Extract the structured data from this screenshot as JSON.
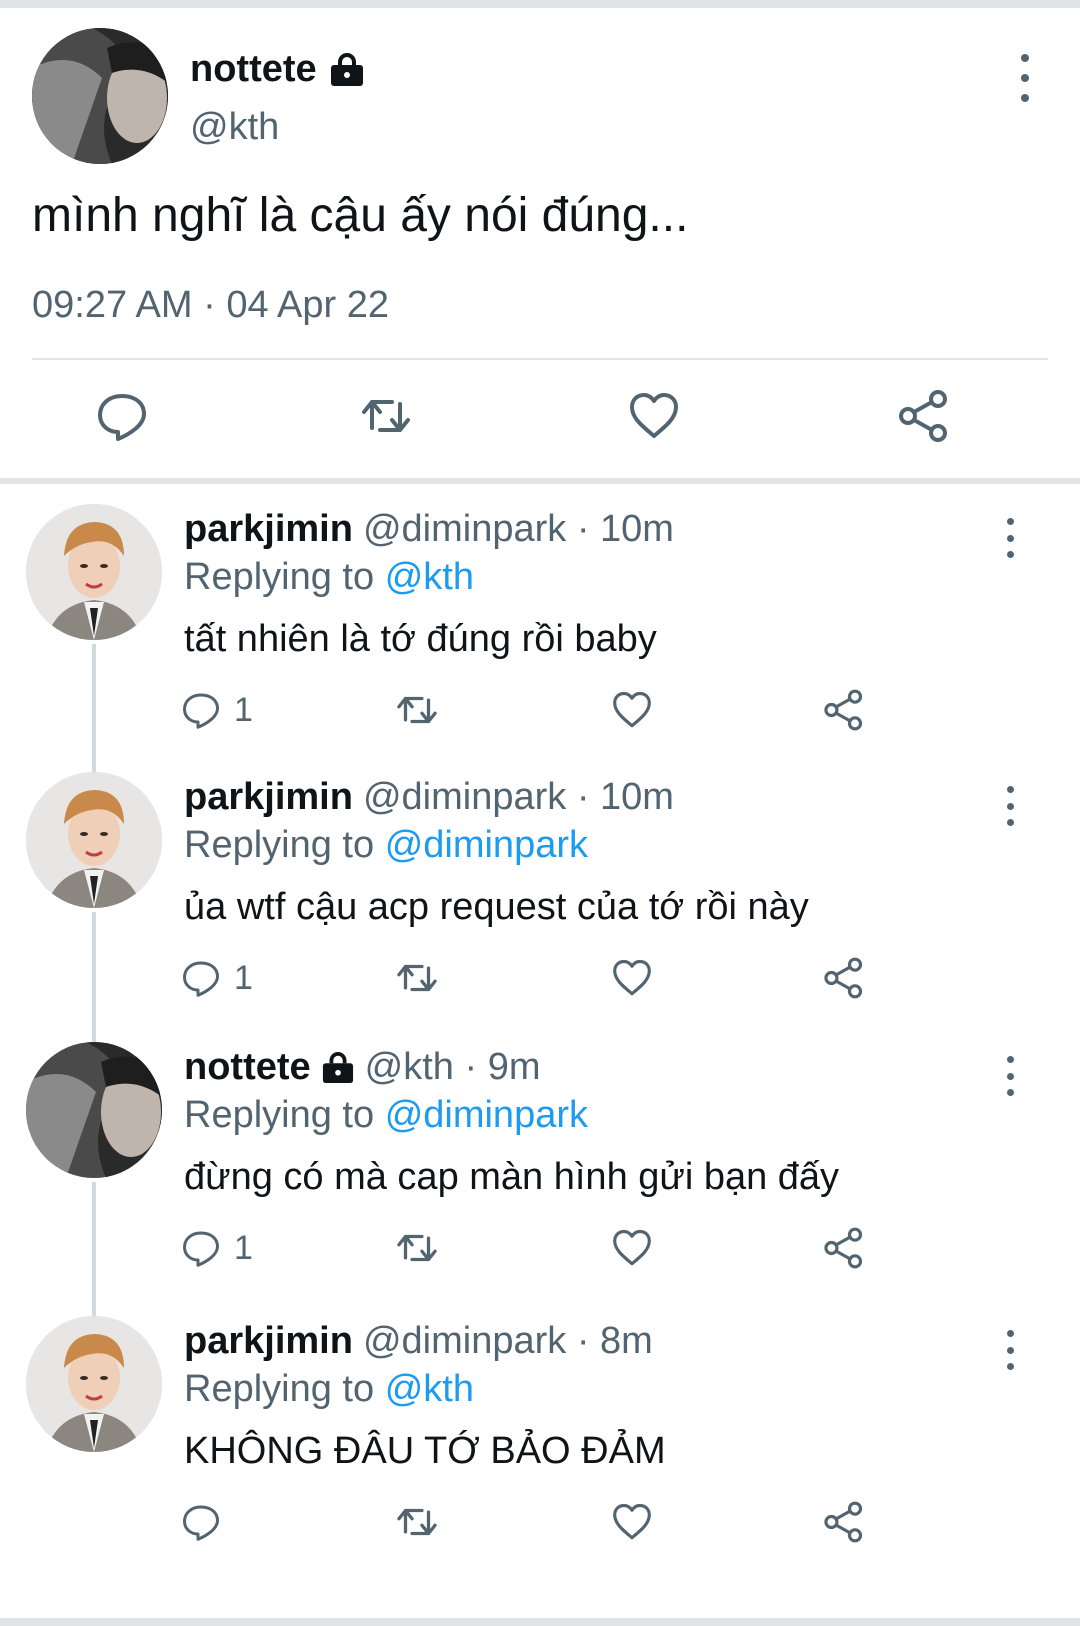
{
  "main_tweet": {
    "display_name": "nottete",
    "handle": "@kth",
    "text": "mình nghĩ là cậu ấy nói đúng...",
    "timestamp": "09:27 AM · 04 Apr 22",
    "avatar_icon": "profile-photo",
    "protected_icon": "lock-icon",
    "actions": [
      "reply-icon",
      "retweet-icon",
      "like-icon",
      "share-icon"
    ]
  },
  "replies": [
    {
      "display_name": "parkjimin",
      "meta": "@diminpark · 10m",
      "replying_prefix": "Replying to",
      "replying_to": "@kth",
      "text": "tất nhiên là tớ đúng rồi baby",
      "reply_count": "1",
      "protected": false
    },
    {
      "display_name": "parkjimin",
      "meta": "@diminpark · 10m",
      "replying_prefix": "Replying to",
      "replying_to": "@diminpark",
      "text": "ủa wtf cậu acp request của tớ rồi này",
      "reply_count": "1",
      "protected": false
    },
    {
      "display_name": "nottete",
      "meta": "@kth · 9m",
      "replying_prefix": "Replying to",
      "replying_to": "@diminpark",
      "text": "đừng có mà cap màn hình gửi bạn đấy",
      "reply_count": "1",
      "protected": true
    },
    {
      "display_name": "parkjimin",
      "meta": "@diminpark · 8m",
      "replying_prefix": "Replying to",
      "replying_to": "@kth",
      "text": "KHÔNG ĐÂU TỚ BẢO ĐẢM",
      "reply_count": "",
      "protected": false
    }
  ],
  "colors": {
    "text": "#0f1419",
    "secondary": "#536471",
    "link": "#1d9bf0",
    "divider": "#e1e4e6"
  }
}
